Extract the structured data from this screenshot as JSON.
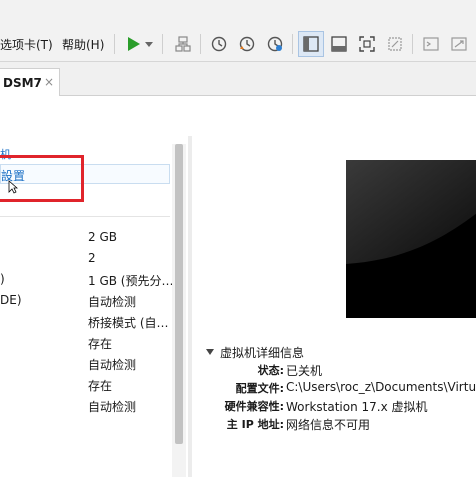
{
  "menubar": {
    "items": [
      "选项卡(T)",
      "帮助(H)"
    ]
  },
  "toolbar": {
    "icons": [
      "play-icon",
      "dropdown-arrow-icon",
      "network-icon",
      "snapshot-icon",
      "revert-snapshot-icon",
      "snapshot-manager-icon",
      "sidebar-view-icon",
      "console-view-icon",
      "fullscreen-icon",
      "unity-icon",
      "terminal-icon",
      "stretch-icon"
    ],
    "accent_color": "#2a9d2a"
  },
  "tabs": [
    {
      "label": "DSM7",
      "close": "×"
    }
  ],
  "left_panel": {
    "header": "机",
    "edit_settings": "設置",
    "devices": [
      {
        "name": "",
        "value": "2 GB"
      },
      {
        "name": "",
        "value": "2"
      },
      {
        "name": ")",
        "value": "1 GB (预先分…"
      },
      {
        "name": "DE)",
        "value": "自动检测"
      },
      {
        "name": "",
        "value": "桥接模式 (自…"
      },
      {
        "name": "",
        "value": "存在"
      },
      {
        "name": "",
        "value": "自动检测"
      },
      {
        "name": "",
        "value": "存在"
      },
      {
        "name": "",
        "value": "自动检测"
      }
    ],
    "highlight_color": "#e0242b"
  },
  "vm_details": {
    "title": "虚拟机详细信息",
    "rows": [
      {
        "label": "状态:",
        "value": "已关机"
      },
      {
        "label": "配置文件:",
        "value": "C:\\Users\\roc_z\\Documents\\Virtual"
      },
      {
        "label": "硬件兼容性:",
        "value": "Workstation 17.x 虚拟机"
      },
      {
        "label": "主 IP 地址:",
        "value": "网络信息不可用"
      }
    ]
  }
}
